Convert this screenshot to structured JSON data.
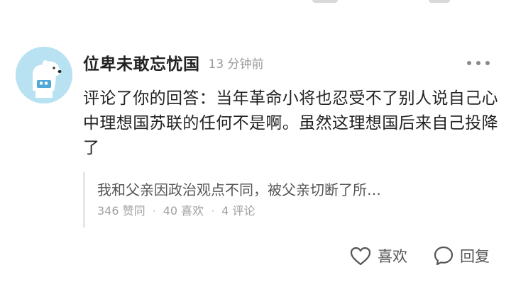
{
  "comment": {
    "username": "位卑未敢忘忧国",
    "timestamp": "13 分钟前",
    "text": "评论了你的回答：当年革命小将也忍受不了别人说自己心中理想国苏联的任何不是啊。虽然这理想国后来自己投降了",
    "quote": {
      "text": "我和父亲因政治观点不同，被父亲切断了所…",
      "upvotes": "346 赞同",
      "likes": "40 喜欢",
      "comments": "4 评论",
      "separator": "·"
    },
    "actions": {
      "like_label": "喜欢",
      "reply_label": "回复"
    },
    "icons": {
      "like": "heart-icon",
      "reply": "speech-bubble-icon",
      "more": "more-horizontal-icon"
    }
  },
  "colors": {
    "avatar_bg": "#b8e2f2",
    "text_primary": "#222222",
    "text_secondary": "#999999",
    "quote_bar": "#e6e6e6"
  }
}
